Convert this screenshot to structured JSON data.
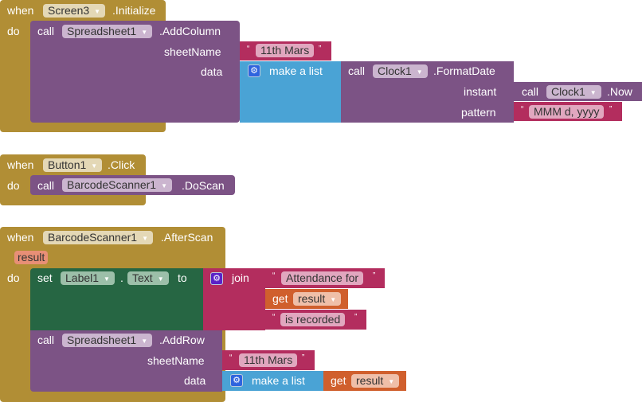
{
  "block1": {
    "when": "when",
    "component": "Screen3",
    "event": ".Initialize",
    "do": "do",
    "call": {
      "keyword": "call",
      "component": "Spreadsheet1",
      "method": ".AddColumn",
      "params": [
        "sheetName",
        "data"
      ],
      "sheetName_value": "11th Mars",
      "make_list": "make a list",
      "format": {
        "keyword": "call",
        "component": "Clock1",
        "method": ".FormatDate",
        "params": [
          "instant",
          "pattern"
        ],
        "instant": {
          "keyword": "call",
          "component": "Clock1",
          "method": ".Now"
        },
        "pattern_value": "MMM d, yyyy"
      }
    }
  },
  "block2": {
    "when": "when",
    "component": "Button1",
    "event": ".Click",
    "do": "do",
    "call": {
      "keyword": "call",
      "component": "BarcodeScanner1",
      "method": ".DoScan"
    }
  },
  "block3": {
    "when": "when",
    "component": "BarcodeScanner1",
    "event": ".AfterScan",
    "param": "result",
    "do": "do",
    "set": {
      "keyword": "set",
      "component": "Label1",
      "dot": ".",
      "property": "Text",
      "to": "to",
      "join": "join",
      "items": [
        "Attendance for ",
        "result",
        " is recorded"
      ],
      "get": "get"
    },
    "call": {
      "keyword": "call",
      "component": "Spreadsheet1",
      "method": ".AddRow",
      "params": [
        "sheetName",
        "data"
      ],
      "sheetName_value": "11th Mars",
      "make_list": "make a list",
      "get": "get",
      "get_var": "result"
    }
  },
  "quote_open": "“",
  "quote_close": "”",
  "dropdown_arrow": "▼",
  "gear_glyph": "⚙"
}
